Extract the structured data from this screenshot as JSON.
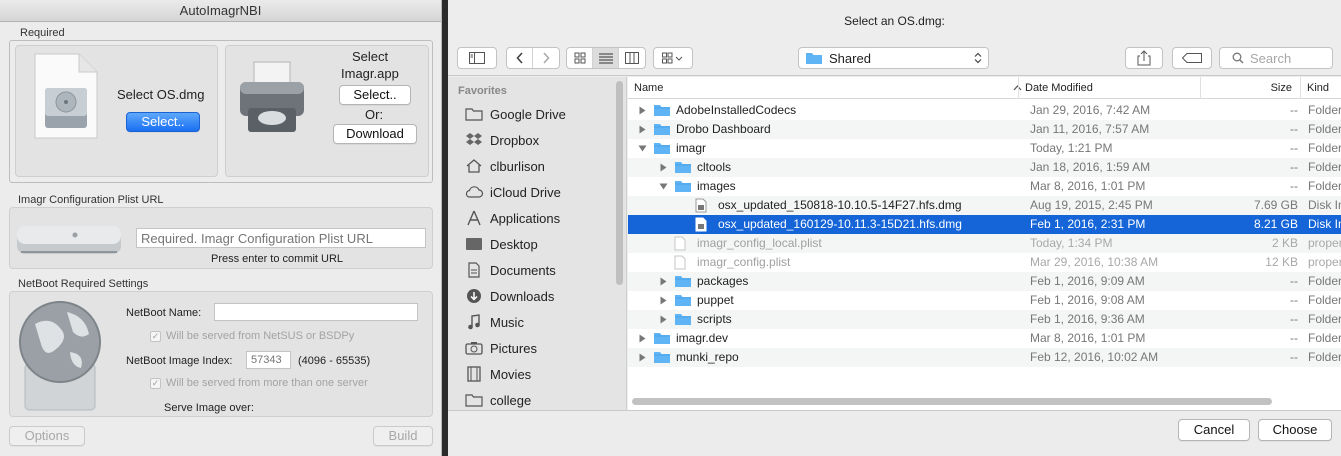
{
  "left": {
    "title": "AutoImagrNBI",
    "required_label": "Required",
    "select_os_label": "Select OS.dmg",
    "select_os_button": "Select..",
    "select_imagr_label_1": "Select",
    "select_imagr_label_2": "Imagr.app",
    "select_imagr_button": "Select..",
    "or_label": "Or:",
    "download_button": "Download",
    "config_label": "Imagr Configuration Plist URL",
    "config_placeholder": "Required. Imagr Configuration Plist URL",
    "config_hint": "Press enter to commit URL",
    "netboot_label": "NetBoot Required Settings",
    "netboot_name_label": "NetBoot Name:",
    "netboot_name_value": "",
    "netsus_check": "Will be served from NetSUS or BSDPy",
    "index_label": "NetBoot Image Index:",
    "index_placeholder": "57343",
    "index_range": "(4096 - 65535)",
    "multi_server_check": "Will be served from more than one server",
    "serve_over_label": "Serve Image over:",
    "options_button": "Options",
    "build_button": "Build"
  },
  "dialog": {
    "title": "Select an OS.dmg:",
    "location": "Shared",
    "search_placeholder": "Search",
    "sidebar_heading": "Favorites",
    "sidebar_items": [
      {
        "label": "Google Drive",
        "icon": "folder-icon"
      },
      {
        "label": "Dropbox",
        "icon": "dropbox-icon"
      },
      {
        "label": "clburlison",
        "icon": "home-icon"
      },
      {
        "label": "iCloud Drive",
        "icon": "cloud-icon"
      },
      {
        "label": "Applications",
        "icon": "applications-icon"
      },
      {
        "label": "Desktop",
        "icon": "desktop-icon"
      },
      {
        "label": "Documents",
        "icon": "documents-icon"
      },
      {
        "label": "Downloads",
        "icon": "downloads-icon"
      },
      {
        "label": "Music",
        "icon": "music-icon"
      },
      {
        "label": "Pictures",
        "icon": "camera-icon"
      },
      {
        "label": "Movies",
        "icon": "film-icon"
      },
      {
        "label": "college",
        "icon": "folder-icon"
      }
    ],
    "columns": {
      "name": "Name",
      "date": "Date Modified",
      "size": "Size",
      "kind": "Kind"
    },
    "rows": [
      {
        "name": "AdobeInstalledCodecs",
        "date": "Jan 29, 2016, 7:42 AM",
        "size": "--",
        "kind": "Folder"
      },
      {
        "name": "Drobo Dashboard",
        "date": "Jan 11, 2016, 7:57 AM",
        "size": "--",
        "kind": "Folder"
      },
      {
        "name": "imagr",
        "date": "Today, 1:21 PM",
        "size": "--",
        "kind": "Folder"
      },
      {
        "name": "cltools",
        "date": "Jan 18, 2016, 1:59 AM",
        "size": "--",
        "kind": "Folder"
      },
      {
        "name": "images",
        "date": "Mar 8, 2016, 1:01 PM",
        "size": "--",
        "kind": "Folder"
      },
      {
        "name": "osx_updated_150818-10.10.5-14F27.hfs.dmg",
        "date": "Aug 19, 2015, 2:45 PM",
        "size": "7.69 GB",
        "kind": "Disk Image"
      },
      {
        "name": "osx_updated_160129-10.11.3-15D21.hfs.dmg",
        "date": "Feb 1, 2016, 2:31 PM",
        "size": "8.21 GB",
        "kind": "Disk Image"
      },
      {
        "name": "imagr_config_local.plist",
        "date": "Today, 1:34 PM",
        "size": "2 KB",
        "kind": "property"
      },
      {
        "name": "imagr_config.plist",
        "date": "Mar 29, 2016, 10:38 AM",
        "size": "12 KB",
        "kind": "property"
      },
      {
        "name": "packages",
        "date": "Feb 1, 2016, 9:09 AM",
        "size": "--",
        "kind": "Folder"
      },
      {
        "name": "puppet",
        "date": "Feb 1, 2016, 9:08 AM",
        "size": "--",
        "kind": "Folder"
      },
      {
        "name": "scripts",
        "date": "Feb 1, 2016, 9:36 AM",
        "size": "--",
        "kind": "Folder"
      },
      {
        "name": "imagr.dev",
        "date": "Mar 8, 2016, 1:01 PM",
        "size": "--",
        "kind": "Folder"
      },
      {
        "name": "munki_repo",
        "date": "Feb 12, 2016, 10:02 AM",
        "size": "--",
        "kind": "Folder"
      }
    ],
    "cancel_button": "Cancel",
    "choose_button": "Choose"
  },
  "colors": {
    "accent": "#1565d8",
    "folder": "#5fb4f5",
    "button_blue": "#1a6ff2"
  }
}
